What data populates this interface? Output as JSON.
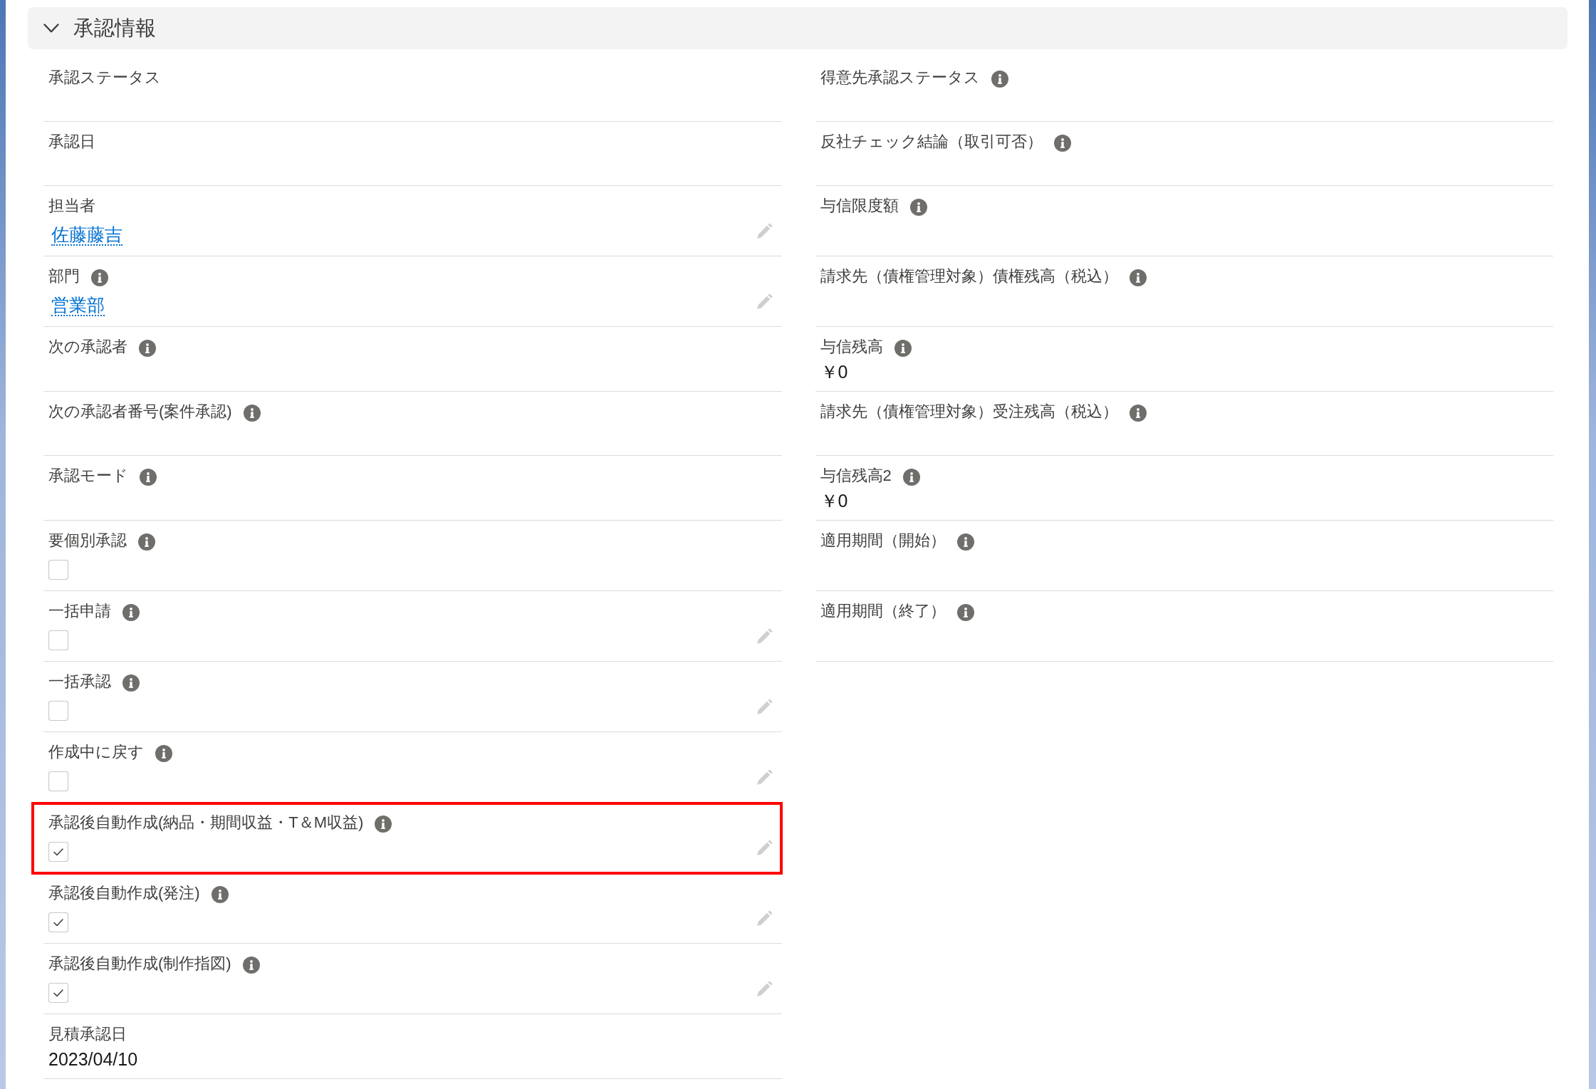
{
  "section": {
    "title": "承認情報",
    "expanded": true
  },
  "left_fields": [
    {
      "label": "承認ステータス",
      "kind": "text",
      "info": false,
      "editable": false,
      "highlighted": false
    },
    {
      "label": "承認日",
      "kind": "text",
      "info": false,
      "editable": false,
      "highlighted": false
    },
    {
      "label": "担当者",
      "kind": "link",
      "value": "佐藤藤吉",
      "info": false,
      "editable": true,
      "highlighted": false
    },
    {
      "label": "部門",
      "kind": "link",
      "value": "営業部",
      "info": true,
      "editable": true,
      "highlighted": false
    },
    {
      "label": "次の承認者",
      "kind": "text",
      "info": true,
      "editable": false,
      "highlighted": false
    },
    {
      "label": "次の承認者番号(案件承認)",
      "kind": "text",
      "info": true,
      "editable": false,
      "highlighted": false
    },
    {
      "label": "承認モード",
      "kind": "text",
      "info": true,
      "editable": false,
      "highlighted": false
    },
    {
      "label": "要個別承認",
      "kind": "checkbox",
      "checked": false,
      "info": true,
      "editable": false,
      "highlighted": false
    },
    {
      "label": "一括申請",
      "kind": "checkbox",
      "checked": false,
      "info": true,
      "editable": true,
      "highlighted": false
    },
    {
      "label": "一括承認",
      "kind": "checkbox",
      "checked": false,
      "info": true,
      "editable": true,
      "highlighted": false
    },
    {
      "label": "作成中に戻す",
      "kind": "checkbox",
      "checked": false,
      "info": true,
      "editable": true,
      "highlighted": false
    },
    {
      "label": "承認後自動作成(納品・期間収益・T＆M収益)",
      "kind": "checkbox",
      "checked": true,
      "info": true,
      "editable": true,
      "highlighted": true
    },
    {
      "label": "承認後自動作成(発注)",
      "kind": "checkbox",
      "checked": true,
      "info": true,
      "editable": true,
      "highlighted": false
    },
    {
      "label": "承認後自動作成(制作指図)",
      "kind": "checkbox",
      "checked": true,
      "info": true,
      "editable": true,
      "highlighted": false
    },
    {
      "label": "見積承認日",
      "kind": "text",
      "value": "2023/04/10",
      "info": false,
      "editable": false,
      "highlighted": false
    }
  ],
  "right_fields": [
    {
      "label": "得意先承認ステータス",
      "kind": "text",
      "info": true,
      "editable": false
    },
    {
      "label": "反社チェック結論（取引可否）",
      "kind": "text",
      "info": true,
      "editable": false
    },
    {
      "label": "与信限度額",
      "kind": "text",
      "info": true,
      "editable": false
    },
    {
      "label": "請求先（債権管理対象）債権残高（税込）",
      "kind": "text",
      "info": true,
      "editable": false
    },
    {
      "label": "与信残高",
      "kind": "text",
      "value": "￥0",
      "info": true,
      "editable": false
    },
    {
      "label": "請求先（債権管理対象）受注残高（税込）",
      "kind": "text",
      "info": true,
      "editable": false
    },
    {
      "label": "与信残高2",
      "kind": "text",
      "value": "￥0",
      "info": true,
      "editable": false
    },
    {
      "label": "適用期間（開始）",
      "kind": "text",
      "info": true,
      "editable": false
    },
    {
      "label": "適用期間（終了）",
      "kind": "text",
      "info": true,
      "editable": false
    }
  ]
}
